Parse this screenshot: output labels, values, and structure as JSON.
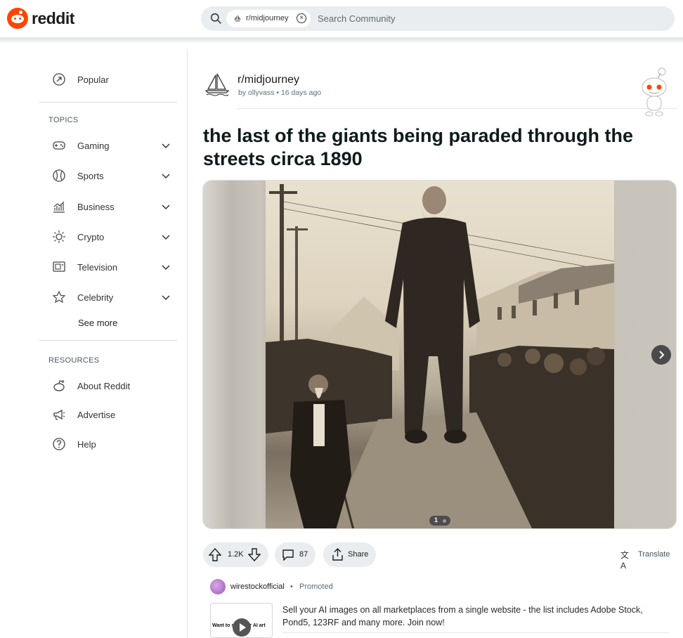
{
  "header": {
    "logo_text": "reddit",
    "search": {
      "community_chip": "r/midjourney",
      "placeholder": "Search Community"
    }
  },
  "sidebar": {
    "top": [
      {
        "label": "Popular",
        "icon": "popular-icon"
      }
    ],
    "topics_title": "TOPICS",
    "topics": [
      {
        "label": "Gaming",
        "icon": "gamepad-icon"
      },
      {
        "label": "Sports",
        "icon": "sports-ball-icon"
      },
      {
        "label": "Business",
        "icon": "chart-icon"
      },
      {
        "label": "Crypto",
        "icon": "crypto-icon"
      },
      {
        "label": "Television",
        "icon": "television-icon"
      },
      {
        "label": "Celebrity",
        "icon": "star-icon"
      }
    ],
    "see_more": "See more",
    "resources_title": "RESOURCES",
    "resources": [
      {
        "label": "About Reddit",
        "icon": "reddit-icon"
      },
      {
        "label": "Advertise",
        "icon": "megaphone-icon"
      },
      {
        "label": "Help",
        "icon": "help-icon"
      }
    ]
  },
  "post": {
    "subreddit": "r/midjourney",
    "author": "ollyvass",
    "time": "16 days ago",
    "meta_sep": "•",
    "title": "the last of the giants being paraded through the streets circa 1890",
    "media": {
      "current_page": "1",
      "total_pages": 2
    },
    "actions": {
      "upvotes": "1.2K",
      "comments": "87",
      "share": "Share",
      "translate": "Translate"
    }
  },
  "promoted": {
    "advertiser": "wirestockofficial",
    "separator": "•",
    "label": "Promoted",
    "thumb_text": "Want to sell your AI art",
    "text": "Sell your AI images on all marketplaces from a single website - the list includes Adobe Stock, Pond5, 123RF and many more. Join now!"
  },
  "colors": {
    "brand": "#ff4500",
    "pill_bg": "#eaedef",
    "search_bg": "#eaedef"
  }
}
